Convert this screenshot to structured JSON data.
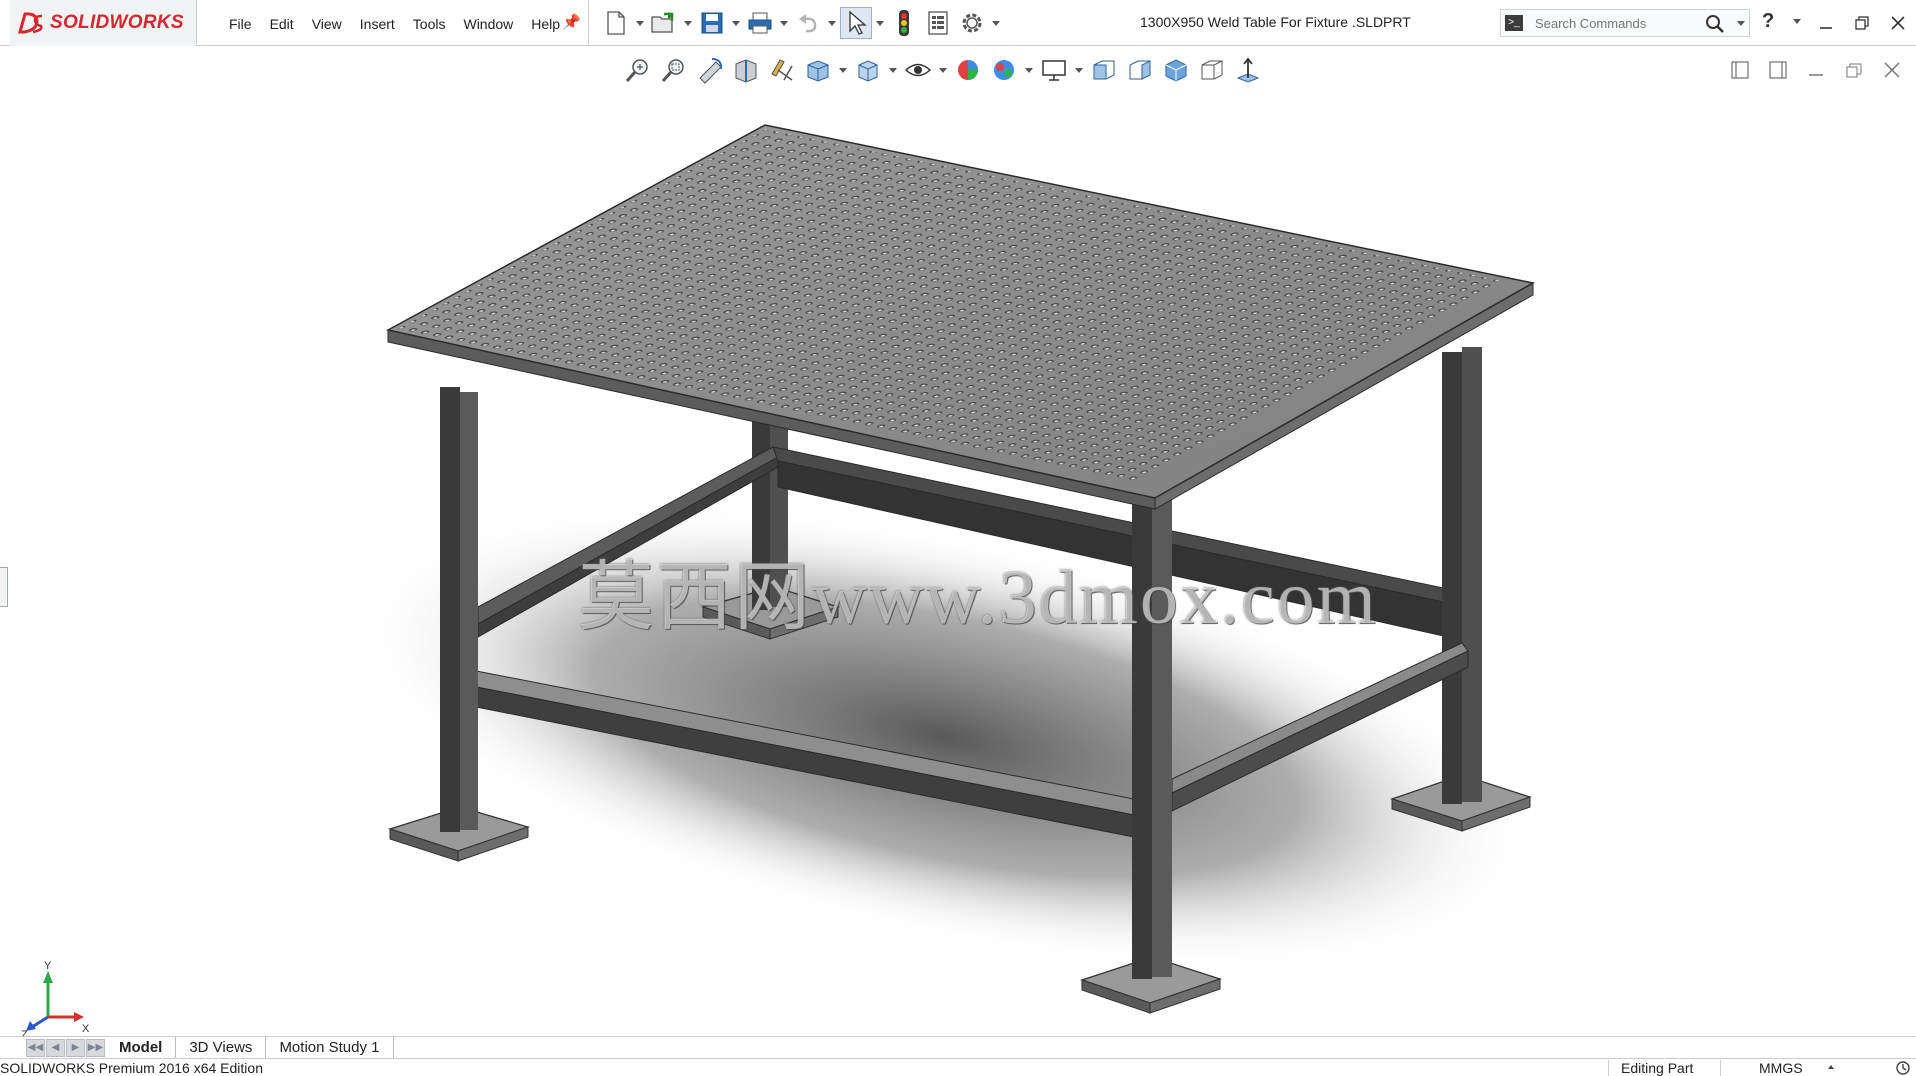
{
  "app": {
    "brand": "SOLIDWORKS",
    "document_title": "1300X950 Weld Table For Fixture .SLDPRT"
  },
  "menu": {
    "items": [
      "File",
      "Edit",
      "View",
      "Insert",
      "Tools",
      "Window",
      "Help"
    ]
  },
  "quick_access": {
    "icons": [
      "new-document-icon",
      "open-icon",
      "save-icon",
      "print-icon",
      "undo-icon",
      "select-arrow-icon",
      "rebuild-icon",
      "file-properties-icon",
      "options-gear-icon"
    ]
  },
  "search": {
    "placeholder": "Search Commands"
  },
  "view_toolbar": {
    "icons": [
      "zoom-to-fit-icon",
      "zoom-to-area-icon",
      "previous-view-icon",
      "section-view-icon",
      "dynamic-annotation-icon",
      "view-orientation-icon",
      "display-style-icon",
      "hide-show-items-icon",
      "edit-appearance-icon",
      "apply-scene-icon",
      "view-settings-icon",
      "front-view-icon",
      "right-view-icon",
      "isometric-view-icon",
      "dimetric-view-icon",
      "normal-to-icon"
    ]
  },
  "graphics": {
    "watermark": "莫西网www.3dmox.com",
    "model": "weld table with perforated fixture top",
    "triad": {
      "x": "X",
      "y": "Y",
      "z": "Z"
    }
  },
  "tabs": {
    "items": [
      "Model",
      "3D Views",
      "Motion Study 1"
    ],
    "active": "Model"
  },
  "status": {
    "edition": "SOLIDWORKS Premium 2016 x64 Edition",
    "mode": "Editing Part",
    "units": "MMGS"
  },
  "colors": {
    "brand_red": "#d7262f",
    "accent_blue": "#1e6fc5",
    "table_steel": "#8a8a8a",
    "frame_dark": "#3c3c3c"
  }
}
